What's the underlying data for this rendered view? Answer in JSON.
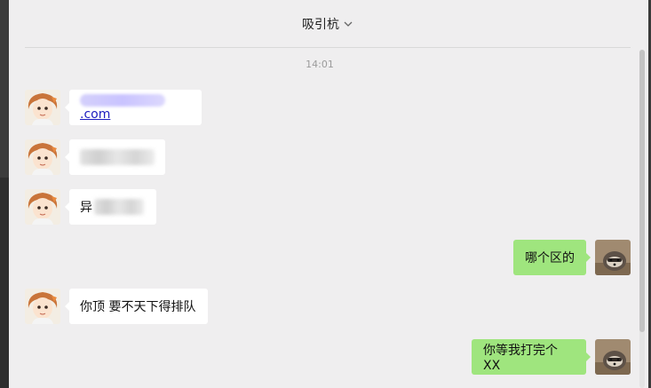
{
  "chat": {
    "title": "吸引杭",
    "timestamp": "14:01"
  },
  "messages": [
    {
      "side": "in",
      "link_suffix": ".com"
    },
    {
      "side": "in"
    },
    {
      "side": "in",
      "text": "异"
    },
    {
      "side": "out",
      "text": "哪个区的"
    },
    {
      "side": "in",
      "text": "你顶 要不天下得排队"
    },
    {
      "side": "out",
      "text": "你等我打完个XX"
    }
  ],
  "colors": {
    "window_bg": "#efeeef",
    "incoming_bubble": "#ffffff",
    "outgoing_bubble": "#9fe57e",
    "link": "#1d1dbf"
  },
  "icons": {
    "title_dropdown": "chevron-down-icon",
    "contact_avatar": "anime-girl-avatar",
    "self_avatar": "raccoon-avatar"
  }
}
